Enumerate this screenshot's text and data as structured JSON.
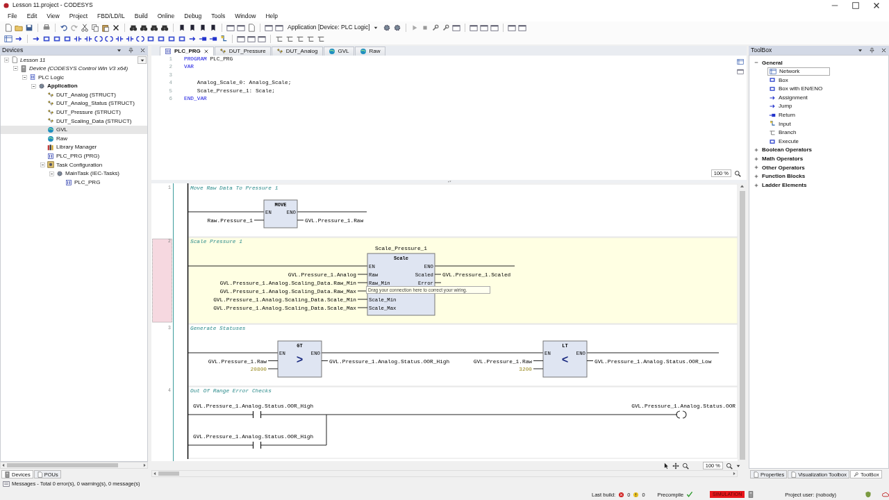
{
  "window": {
    "title": "Lesson 11.project - CODESYS"
  },
  "menu": [
    "File",
    "Edit",
    "View",
    "Project",
    "FBD/LD/IL",
    "Build",
    "Online",
    "Debug",
    "Tools",
    "Window",
    "Help"
  ],
  "toolbar": {
    "application": "Application [Device: PLC Logic]"
  },
  "devices": {
    "title": "Devices",
    "tree": [
      {
        "label": "Lesson 11",
        "kind": "project",
        "expanded": true,
        "selected": false,
        "children": [
          {
            "label": "Device (CODESYS Control Win V3 x64)",
            "kind": "device",
            "expanded": true,
            "selected": false,
            "children": [
              {
                "label": "PLC Logic",
                "kind": "plc",
                "expanded": true,
                "selected": false,
                "children": [
                  {
                    "label": "Application",
                    "kind": "application",
                    "expanded": true,
                    "selected": false,
                    "children": [
                      {
                        "label": "DUT_Analog (STRUCT)",
                        "kind": "dut",
                        "selected": false
                      },
                      {
                        "label": "DUT_Analog_Status (STRUCT)",
                        "kind": "dut",
                        "selected": false
                      },
                      {
                        "label": "DUT_Pressure (STRUCT)",
                        "kind": "dut",
                        "selected": false
                      },
                      {
                        "label": "DUT_Scaling_Data (STRUCT)",
                        "kind": "dut",
                        "selected": false
                      },
                      {
                        "label": "GVL",
                        "kind": "gvl",
                        "selected": true
                      },
                      {
                        "label": "Raw",
                        "kind": "gvl",
                        "selected": false
                      },
                      {
                        "label": "Library Manager",
                        "kind": "library",
                        "selected": false
                      },
                      {
                        "label": "PLC_PRG (PRG)",
                        "kind": "pou",
                        "selected": false
                      },
                      {
                        "label": "Task Configuration",
                        "kind": "task",
                        "expanded": true,
                        "selected": false,
                        "children": [
                          {
                            "label": "MainTask (IEC-Tasks)",
                            "kind": "maintask",
                            "expanded": true,
                            "selected": false,
                            "children": [
                              {
                                "label": "PLC_PRG",
                                "kind": "call",
                                "selected": false
                              }
                            ]
                          }
                        ]
                      }
                    ]
                  }
                ]
              }
            ]
          }
        ]
      }
    ],
    "tabs": [
      {
        "label": "Devices",
        "selected": true
      },
      {
        "label": "POUs",
        "selected": false
      }
    ]
  },
  "editor": {
    "tabs": [
      {
        "label": "PLC_PRG",
        "kind": "pou",
        "selected": true
      },
      {
        "label": "DUT_Pressure",
        "kind": "dut",
        "selected": false
      },
      {
        "label": "DUT_Analog",
        "kind": "dut",
        "selected": false
      },
      {
        "label": "GVL",
        "kind": "gvl",
        "selected": false
      },
      {
        "label": "Raw",
        "kind": "gvl",
        "selected": false
      }
    ],
    "declaration": {
      "lines": [
        {
          "number": "1",
          "parts": [
            {
              "text": "PROGRAM",
              "kind": "keyword"
            },
            {
              "text": " PLC_PRG"
            }
          ]
        },
        {
          "number": "2",
          "parts": [
            {
              "text": "VAR",
              "kind": "keyword"
            }
          ]
        },
        {
          "number": "3"
        },
        {
          "number": "4",
          "parts": [
            {
              "text": "    Analog_Scale_0: Analog_Scale;"
            }
          ]
        },
        {
          "number": "5",
          "parts": [
            {
              "text": "    Scale_Pressure_1: Scale;"
            }
          ]
        },
        {
          "number": "6",
          "parts": [
            {
              "text": "END_VAR",
              "kind": "keyword"
            }
          ]
        }
      ],
      "zoom": "100 %"
    },
    "networks": [
      {
        "number": "1",
        "comment": "Move Raw Data To Pressure 1",
        "selected": false,
        "kind": "boxes",
        "boxes": [
          {
            "type": "MOVE",
            "inputs": [
              {
                "pin": "EN"
              },
              {
                "var": "Raw.Pressure_1"
              }
            ],
            "outputs": [
              {
                "pin": "ENO"
              },
              {
                "var": "GVL.Pressure_1.Raw"
              }
            ]
          }
        ]
      },
      {
        "number": "2",
        "comment": "Scale Pressure 1",
        "selected": true,
        "kind": "boxes",
        "tooltip": "Drag your connection here to correct your wiring.",
        "boxes": [
          {
            "type": "Scale",
            "instance": "Scale_Pressure_1",
            "inputs": [
              {
                "pin": "EN"
              },
              {
                "pin": "Raw",
                "var": "GVL.Pressure_1.Analog"
              },
              {
                "pin": "Raw_Min",
                "var": "GVL.Pressure_1.Analog.Scaling_Data.Raw_Min"
              },
              {
                "var": "GVL.Pressure_1.Analog.Scaling_Data.Raw_Max"
              },
              {
                "pin": "Scale_Min",
                "var": "GVL.Pressure_1.Analog.Scaling_Data.Scale_Min"
              },
              {
                "pin": "Scale_Max",
                "var": "GVL.Pressure_1.Analog.Scaling_Data.Scale_Max"
              }
            ],
            "outputs": [
              {
                "pin": "ENO"
              },
              {
                "pin": "Scaled",
                "var": "GVL.Pressure_1.Scaled"
              },
              {
                "pin": "Error"
              }
            ]
          }
        ]
      },
      {
        "number": "3",
        "comment": "Generate Statuses",
        "selected": false,
        "kind": "boxes",
        "boxes": [
          {
            "type": "GT",
            "symbol": ">",
            "inputs": [
              {
                "pin": "EN"
              },
              {
                "var": "GVL.Pressure_1.Raw"
              },
              {
                "var": "20800",
                "kind": "constant"
              }
            ],
            "outputs": [
              {
                "pin": "ENO"
              },
              {
                "var": "GVL.Pressure_1.Analog.Status.OOR_High"
              }
            ]
          },
          {
            "type": "LT",
            "symbol": "<",
            "inputs": [
              {
                "pin": "EN"
              },
              {
                "var": "GVL.Pressure_1.Raw"
              },
              {
                "var": "3200",
                "kind": "constant"
              }
            ],
            "outputs": [
              {
                "pin": "ENO"
              },
              {
                "var": "GVL.Pressure_1.Analog.Status.OOR_Low"
              }
            ]
          }
        ]
      },
      {
        "number": "4",
        "comment": "Out Of Range Error Checks",
        "selected": false,
        "kind": "ladder",
        "contacts": [
          {
            "var": "GVL.Pressure_1.Analog.Status.OOR_High"
          },
          {
            "var": "GVL.Pressure_1.Analog.Status.OOR_High"
          }
        ],
        "coil": {
          "var": "GVL.Pressure_1.Analog.Status.OOR"
        }
      }
    ],
    "zoom": "100 %"
  },
  "toolbox": {
    "title": "ToolBox",
    "groups": [
      {
        "label": "General",
        "expanded": true,
        "items": [
          {
            "label": "Network",
            "kind": "network",
            "selected": true
          },
          {
            "label": "Box",
            "kind": "box",
            "selected": false
          },
          {
            "label": "Box with EN/ENO",
            "kind": "box_en",
            "selected": false
          },
          {
            "label": "Assignment",
            "kind": "assignment",
            "selected": false
          },
          {
            "label": "Jump",
            "kind": "jump",
            "selected": false
          },
          {
            "label": "Return",
            "kind": "return",
            "selected": false
          },
          {
            "label": "Input",
            "kind": "input",
            "selected": false
          },
          {
            "label": "Branch",
            "kind": "branch",
            "selected": false
          },
          {
            "label": "Execute",
            "kind": "execute",
            "selected": false
          }
        ]
      },
      {
        "label": "Boolean Operators",
        "expanded": false
      },
      {
        "label": "Math Operators",
        "expanded": false
      },
      {
        "label": "Other Operators",
        "expanded": false
      },
      {
        "label": "Function Blocks",
        "expanded": false
      },
      {
        "label": "Ladder Elements",
        "expanded": false
      }
    ],
    "tabs": [
      {
        "label": "Properties",
        "selected": false
      },
      {
        "label": "Visualization Toolbox",
        "selected": false
      },
      {
        "label": "ToolBox",
        "selected": true
      }
    ]
  },
  "messages": "Messages - Total 0 error(s), 0 warning(s), 0 message(s)",
  "status_bar": {
    "last_build": "Last build:",
    "errors": "0",
    "warnings": "0",
    "precompile": "Precompile",
    "mode": "SIMULATION",
    "user": "Project user: (nobody)"
  }
}
